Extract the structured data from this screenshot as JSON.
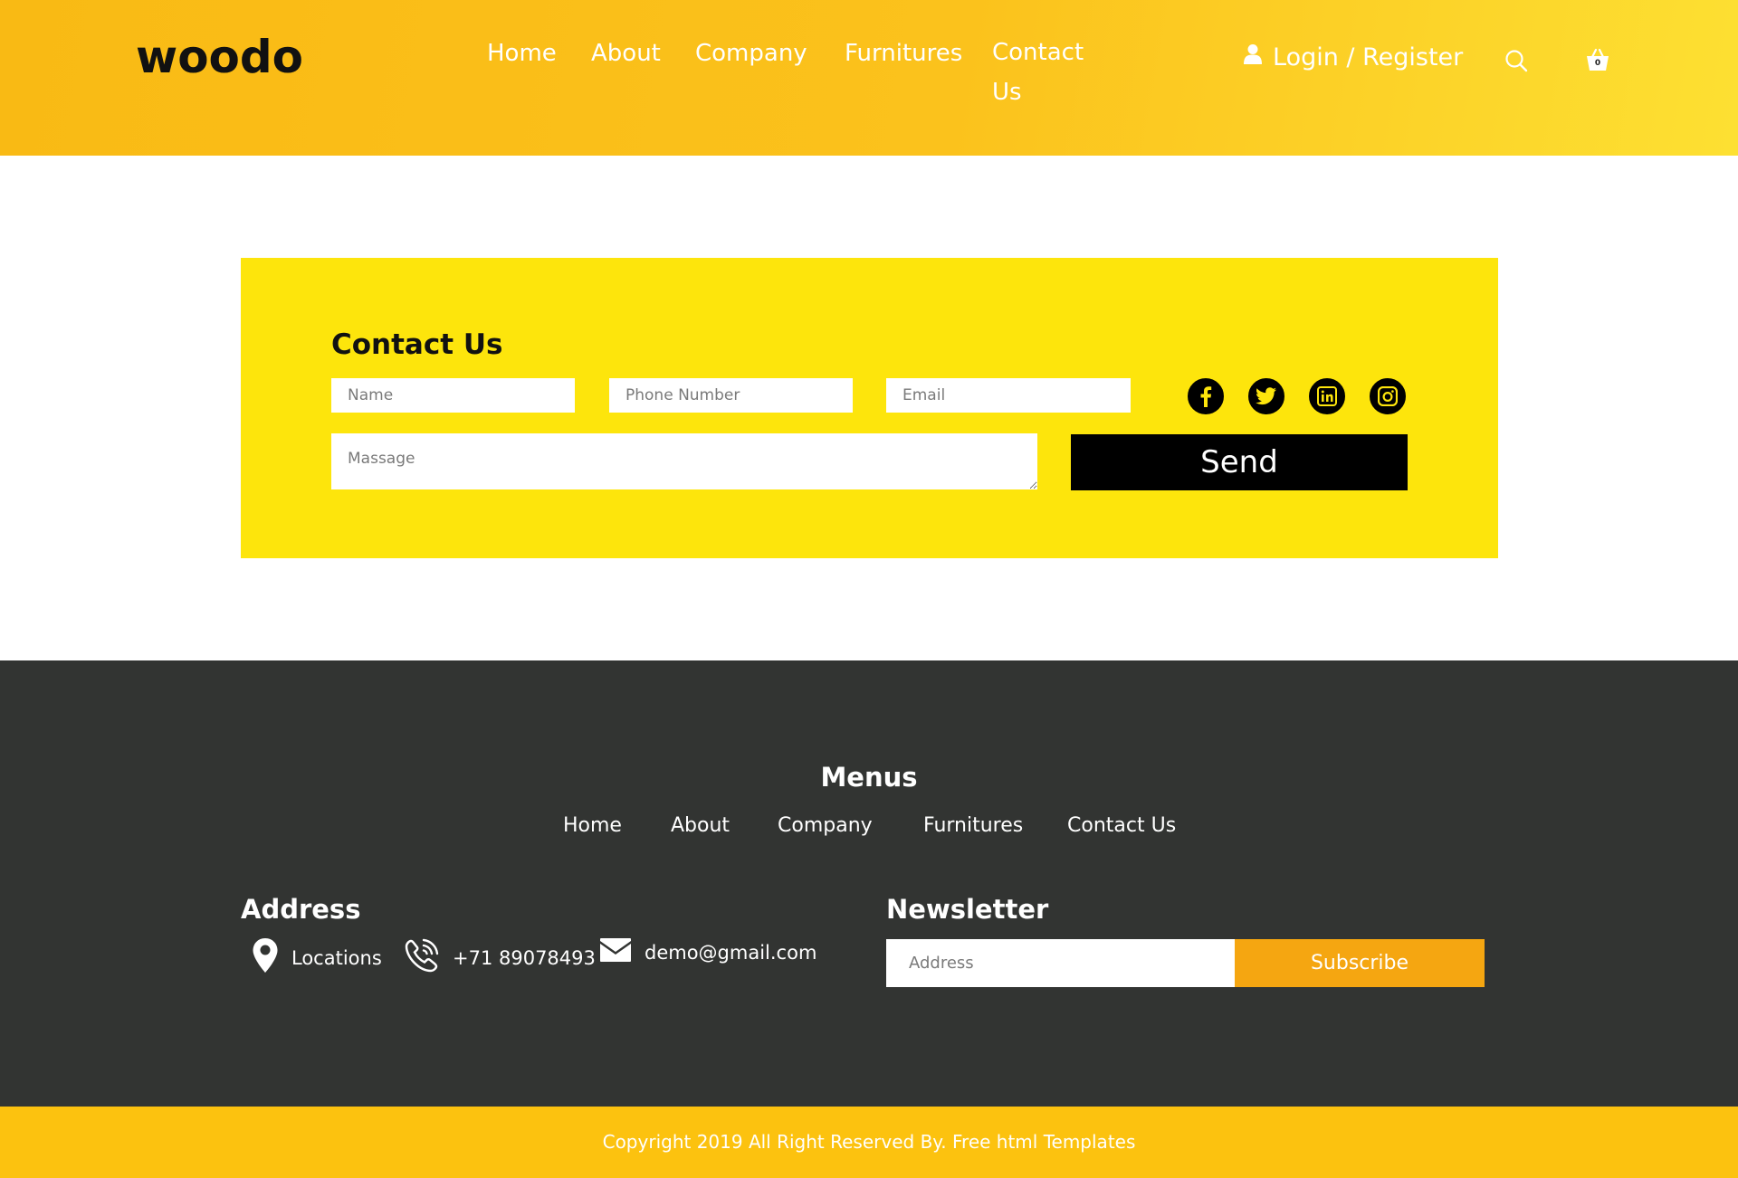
{
  "header": {
    "logo": "woodo",
    "nav": [
      "Home",
      "About",
      "Company",
      "Furnitures",
      "Contact Us"
    ],
    "login_label": "Login / Register",
    "cart_count": "0"
  },
  "contact": {
    "title": "Contact Us",
    "name_placeholder": "Name",
    "phone_placeholder": "Phone Number",
    "email_placeholder": "Email",
    "message_placeholder": "Massage",
    "send_label": "Send",
    "socials": [
      "facebook-icon",
      "twitter-icon",
      "linkedin-icon",
      "instagram-icon"
    ]
  },
  "footer": {
    "menus_title": "Menus",
    "menu_items": [
      "Home",
      "About",
      "Company",
      "Furnitures",
      "Contact Us"
    ],
    "address_title": "Address",
    "location_label": "Locations",
    "phone": "+71 89078493",
    "email": "demo@gmail.com",
    "newsletter_title": "Newsletter",
    "newsletter_placeholder": "Address",
    "subscribe_label": "Subscribe"
  },
  "copyright": "Copyright 2019 All Right Reserved By. Free html Templates",
  "colors": {
    "header_yellow": "#fbc21c",
    "contact_yellow": "#fde50c",
    "footer_dark": "#323432",
    "subscribe_orange": "#f5a611",
    "copyright_yellow": "#fcc20f"
  }
}
